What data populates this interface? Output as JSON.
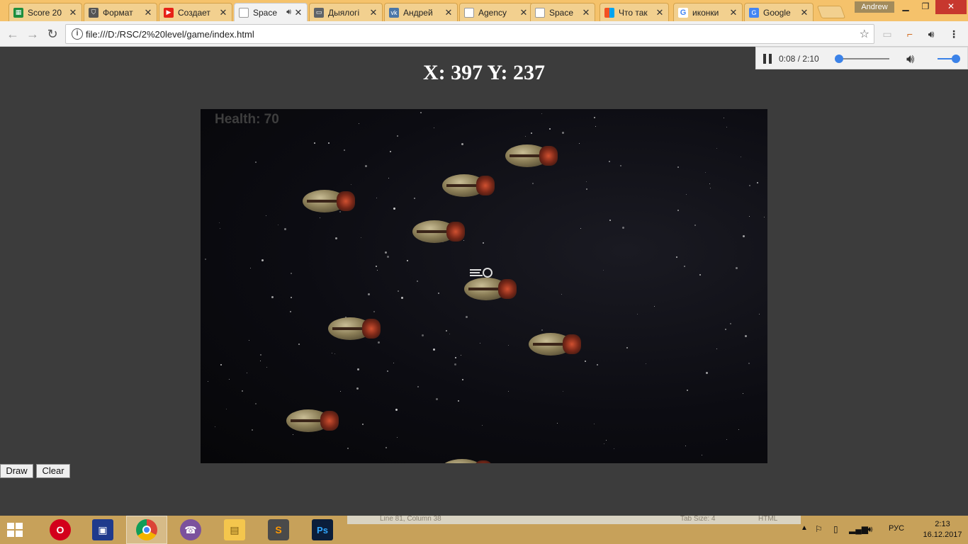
{
  "browser": {
    "tabs": [
      {
        "title": "Score 20",
        "icon": "sheets-icon",
        "color": "#1e8e3e",
        "active": false
      },
      {
        "title": "Формат",
        "icon": "shield-icon",
        "color": "#555555",
        "active": false
      },
      {
        "title": "Создает",
        "icon": "youtube-icon",
        "color": "#e62117",
        "active": false
      },
      {
        "title": "Space",
        "icon": "page-icon",
        "color": "#777777",
        "active": true,
        "audio": true
      },
      {
        "title": "Дыялогі",
        "icon": "chat-icon",
        "color": "#5f6368",
        "active": false
      },
      {
        "title": "Андрей",
        "icon": "vk-icon",
        "color": "#4a76a8",
        "active": false
      },
      {
        "title": "Agency",
        "icon": "page-icon",
        "color": "#777777",
        "active": false
      },
      {
        "title": "Space",
        "icon": "page-icon",
        "color": "#777777",
        "active": false
      },
      {
        "title": "Что так",
        "icon": "windows-icon",
        "color": "#f2a600",
        "active": false
      },
      {
        "title": "иконки",
        "icon": "google-icon",
        "color": "#4285f4",
        "active": false
      },
      {
        "title": "Google",
        "icon": "google-translate-icon",
        "color": "#4285f4",
        "active": false
      }
    ],
    "profile_name": "Andrew",
    "url": "file:///D:/RSC/2%20level/game/index.html"
  },
  "media": {
    "time": "0:08 / 2:10",
    "progress": 0.06,
    "volume": 0.85
  },
  "page": {
    "coords_text": "X: 397 Y: 237",
    "health_text": "Health: 70",
    "draw_label": "Draw",
    "clear_label": "Clear"
  },
  "taskbar": {
    "apps": [
      "opera-icon",
      "save-disk-icon",
      "chrome-icon",
      "viber-icon",
      "file-explorer-icon",
      "sublime-text-icon",
      "photoshop-icon"
    ],
    "ghost_status": {
      "position": "Line 81, Column 38",
      "tab_size": "Tab Size: 4",
      "syntax": "HTML"
    },
    "language": "РУС",
    "time": "2:13",
    "date": "16.12.2017"
  }
}
